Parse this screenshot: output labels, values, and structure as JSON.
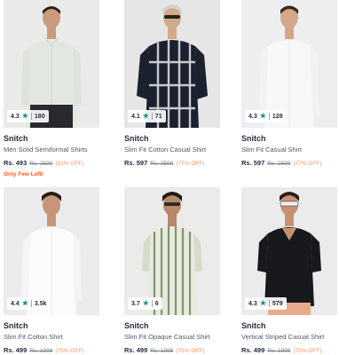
{
  "products": [
    {
      "rating": "4.3",
      "count": "180",
      "brand": "Snitch",
      "title": "Men Solid Semiformal Shirts",
      "price": "Rs. 493",
      "mrp": "Rs. 2599",
      "off": "(81% OFF)",
      "note": "Only Few Left!",
      "shirt_color": "#e4e8e3",
      "bg": "#eaeae8"
    },
    {
      "rating": "4.1",
      "count": "71",
      "brand": "Snitch",
      "title": "Slim Fit Cotton Casual Shirt",
      "price": "Rs. 597",
      "mrp": "Rs. 2599",
      "off": "(77% OFF)",
      "note": "",
      "shirt_color": "#1c2130",
      "bg": "#e6e6e6"
    },
    {
      "rating": "4.3",
      "count": "128",
      "brand": "Snitch",
      "title": "Slim Fit Casual Shirt",
      "price": "Rs. 597",
      "mrp": "Rs. 2599",
      "off": "(77% OFF)",
      "note": "",
      "shirt_color": "#f6f6f6",
      "bg": "#eceef0"
    },
    {
      "rating": "4.4",
      "count": "3.5k",
      "brand": "Snitch",
      "title": "Slim Fit Cotton Shirt",
      "price": "Rs. 499",
      "mrp": "Rs. 1998",
      "off": "(75% OFF)",
      "note": "",
      "shirt_color": "#fbfbfb",
      "bg": "#ebebed"
    },
    {
      "rating": "3.7",
      "count": "6",
      "brand": "Snitch",
      "title": "Slim Fit Opaque Casual Shirt",
      "price": "Rs. 499",
      "mrp": "Rs. 1998",
      "off": "(75% OFF)",
      "note": "",
      "shirt_color": "#c9cdb7",
      "bg": "#ebebe9"
    },
    {
      "rating": "4.3",
      "count": "579",
      "brand": "Snitch",
      "title": "Vertical Striped Casual Shirt",
      "price": "Rs. 499",
      "mrp": "Rs. 1998",
      "off": "(75% OFF)",
      "note": "",
      "shirt_color": "#17191d",
      "bg": "#ebebeb"
    }
  ]
}
